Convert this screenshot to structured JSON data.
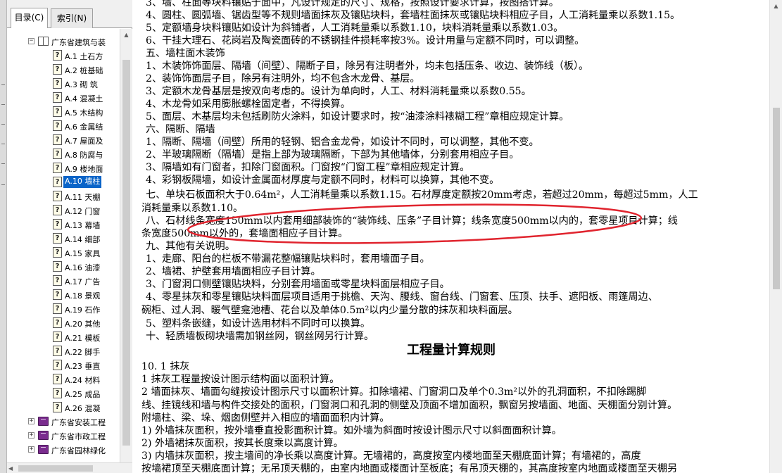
{
  "nav": {
    "tabs": [
      {
        "label": "目录(C)"
      },
      {
        "label": "索引(N)"
      }
    ],
    "root": {
      "label": "广东省建筑与装"
    },
    "items": [
      {
        "label": "A.1  土石方"
      },
      {
        "label": "A.2  桩基础"
      },
      {
        "label": "A.3  砌  筑"
      },
      {
        "label": "A.4  混凝土"
      },
      {
        "label": "A.5  木结构"
      },
      {
        "label": "A.6  金属结"
      },
      {
        "label": "A.7  屋面及"
      },
      {
        "label": "A.8  防腐与"
      },
      {
        "label": "A.9  楼地面"
      },
      {
        "label": "A.10  墙柱"
      },
      {
        "label": "A.11  天棚"
      },
      {
        "label": "A.12  门窗"
      },
      {
        "label": "A.13  幕墙"
      },
      {
        "label": "A.14  细部"
      },
      {
        "label": "A.15  家具"
      },
      {
        "label": "A.16  油漆"
      },
      {
        "label": "A.17  广告"
      },
      {
        "label": "A.18  景观"
      },
      {
        "label": "A.19  石作"
      },
      {
        "label": "A.20  其他"
      },
      {
        "label": "A.21  模板"
      },
      {
        "label": "A.22  脚手"
      },
      {
        "label": "A.23  垂直"
      },
      {
        "label": "A.24  材料"
      },
      {
        "label": "A.25  成品"
      },
      {
        "label": "A.26  混凝"
      }
    ],
    "books": [
      {
        "label": "广东省安装工程"
      },
      {
        "label": "广东省市政工程"
      },
      {
        "label": "广东省园林绿化"
      }
    ]
  },
  "doc": {
    "lines": [
      {
        "text": "    3、墙、柱面等块料镶贴于面中，凡设计规定的尺寸、规格，按照设计要求计算，按图搭计算。"
      },
      {
        "text": "    4、圆柱、圆弧墙、锯齿型等不规则墙面抹灰及镶贴块料，套墙柱面抹灰或镶贴块料相应子目，人工消耗量乘以系数1.15。"
      },
      {
        "text": "    5、定额墙身块料镶贴如设计为斜铺者，人工消耗量乘以系数1.10，块料消耗量乘以系数1.03。"
      },
      {
        "text": "    6、干挂大理石、花岗岩及陶瓷面砖的不锈钢挂件损耗率按3%。设计用量与定额不同时，可以调整。"
      },
      {
        "text": "    五、墙柱面木装饰"
      },
      {
        "text": "    1、木装饰饰面层、隔墙（间壁）、隔断子目，除另有注明者外，均未包括压条、收边、装饰线（板）。"
      },
      {
        "text": "    2、装饰饰面层子目，除另有注明外，均不包含木龙骨、基层。"
      },
      {
        "text": "    3、定额木龙骨基层是按双向考虑的。设计为单向时，人工、材料消耗量乘以系数0.55。"
      },
      {
        "text": "    4、木龙骨如采用膨胀螺栓固定者，不得换算。"
      },
      {
        "text": "    5、面层、木基层均未包括刷防火涂料，如设计要求时，按“油漆涂料裱糊工程”章相应规定计算。"
      },
      {
        "text": "    六、隔断、隔墙"
      },
      {
        "text": "    1、隔断、隔墙（间壁）所用的轻钢、铝合金龙骨，如设计不同时，可以调整，其他不变。"
      },
      {
        "text": "    2、半玻璃隔断（隔墙）是指上部为玻璃隔断，下部为其他墙体，分别套用相应子目。"
      },
      {
        "text": "    3、隔墙如有门窗者，扣除门窗面积。门窗按“门窗工程”章相应规定计算。"
      },
      {
        "text": "    4、彩钢板隔墙，如设计金属面材厚度与定额不同时，材料可以换算，其他不变。"
      },
      {
        "text": "    七、单块石板面积大于0.64m²，人工消耗量乘以系数1.15。石材厚度定额按20mm考虑，若超过20mm，每超过5mm，人工"
      },
      {
        "text": "消耗量乘以系数1.10。"
      },
      {
        "text": "    八、石材线条宽度150mm以内套用细部装饰的“装饰线、压条”子目计算；线条宽度500mm以内的，套零星项目计算；线"
      },
      {
        "text": "条宽度500mm以外的，套墙面相应子目计算。"
      },
      {
        "text": "    九、其他有关说明。"
      },
      {
        "text": "    1、走廊、阳台的栏板不带漏花整幅镶贴块料时，套用墙面子目。"
      },
      {
        "text": "    2、墙裙、护壁套用墙面相应子目计算。"
      },
      {
        "text": "    3、门窗洞口侧壁镶贴块料，分别套用墙面或零星块料面层相应子目。"
      },
      {
        "text": "    4、零星抹灰和零星镶贴块料面层项目适用于挑檐、天沟、腰线、窗台线、门窗套、压顶、扶手、遮阳板、雨篷周边、"
      },
      {
        "text": "碗柜、过人洞、暖气壁龛池槽、花台以及单体0.5m²以内少量分散的抹灰和块料面层。"
      },
      {
        "text": "    5、塑料条嵌缝，如设计选用材料不同时可以换算。"
      },
      {
        "text": "    十、轻质墙板砌块墙需加钢丝网，钢丝网另行计算。"
      }
    ],
    "heading": "工程量计算规则",
    "lines2": [
      {
        "text": "10. 1  抹灰"
      },
      {
        "text": "    1  抹灰工程量按设计图示结构面以面积计算。"
      },
      {
        "text": "    2  墙面抹灰、墙面勾缝按设计图示尺寸以面积计算。扣除墙裙、门窗洞口及单个0.3m²以外的孔洞面积，不扣除踢脚"
      },
      {
        "text": "线、挂镜线和墙与构件交接处的面积，门窗洞口和孔洞的侧壁及顶面不增加面积，飘窗另按墙面、地面、天棚面分别计算。"
      },
      {
        "text": "附墙柱、梁、垛、烟囱侧壁并入相应的墙面面积内计算。"
      },
      {
        "text": "    1)    外墙抹灰面积，按外墙垂直投影面积计算。如外墙为斜面时按设计图示尺寸以斜面面积计算。"
      },
      {
        "text": "    2)    外墙裙抹灰面积，按其长度乘以高度计算。"
      },
      {
        "text": "    3)    内墙抹灰面积，按主墙间的净长乘以高度计算。无墙裙的，高度按室内楼地面至天棚底面计算；有墙裙的，高度"
      },
      {
        "text": "按墙裙顶至天棚底面计算；无吊顶天棚的，由室内地面或楼面计至板底；有吊顶天棚的，其高度按室内地面或楼面至天棚另"
      }
    ]
  },
  "annotation": {
    "color": "#e0242e"
  }
}
